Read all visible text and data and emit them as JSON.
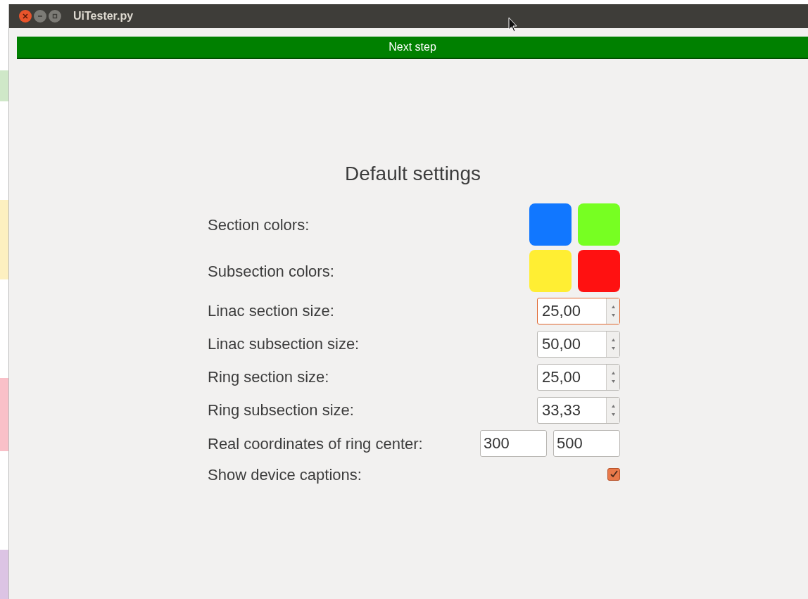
{
  "window": {
    "title": "UiTester.py"
  },
  "next_button": {
    "label": "Next step"
  },
  "heading": "Default settings",
  "rows": [
    {
      "kind": "colors",
      "label": "Section colors:",
      "swatches": [
        {
          "color": "#1177ff"
        },
        {
          "color": "#77ff22"
        }
      ]
    },
    {
      "kind": "colors",
      "label": "Subsection colors:",
      "swatches": [
        {
          "color": "#ffee33"
        },
        {
          "color": "#ff1111"
        }
      ]
    },
    {
      "kind": "spin",
      "label": "Linac section size:",
      "value": "25,00",
      "focused": true
    },
    {
      "kind": "spin",
      "label": "Linac subsection size:",
      "value": "50,00",
      "focused": false
    },
    {
      "kind": "spin",
      "label": "Ring section size:",
      "value": "25,00",
      "focused": false
    },
    {
      "kind": "spin",
      "label": "Ring subsection size:",
      "value": "33,33",
      "focused": false
    },
    {
      "kind": "pair",
      "label": "Real coordinates of ring center:",
      "values": [
        "300",
        "500"
      ]
    },
    {
      "kind": "checkbox",
      "label": "Show device captions:",
      "checked": true
    }
  ]
}
